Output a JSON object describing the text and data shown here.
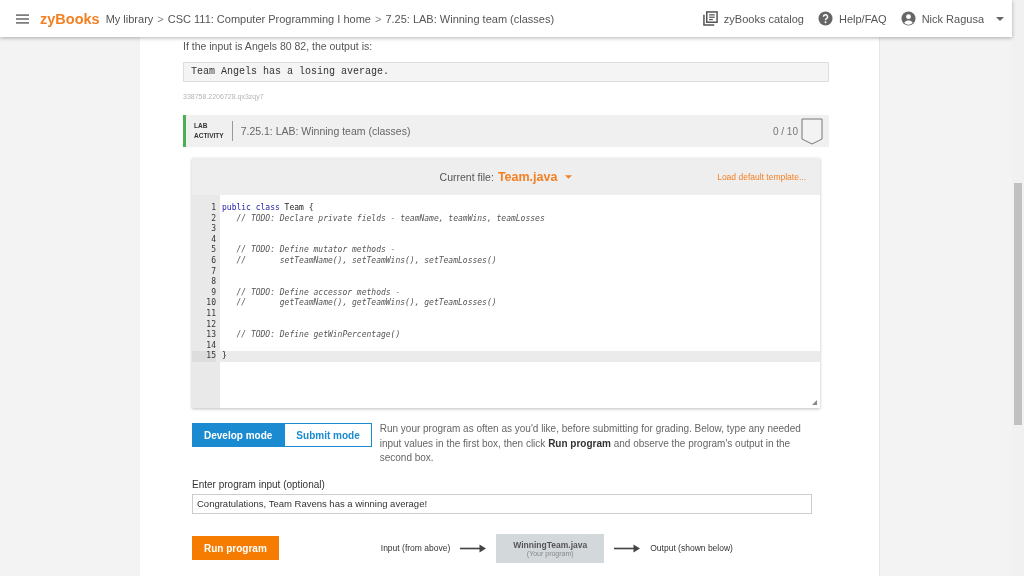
{
  "header": {
    "logo": "zyBooks",
    "breadcrumb": [
      {
        "kind": "link",
        "text": "My library"
      },
      {
        "kind": "sep",
        "text": ">"
      },
      {
        "kind": "link",
        "text": "CSC 111: Computer Programming I home"
      },
      {
        "kind": "sep",
        "text": ">"
      },
      {
        "kind": "link",
        "text": "7.25: LAB: Winning team (classes)"
      }
    ],
    "catalog": "zyBooks catalog",
    "help": "Help/FAQ",
    "user": "Nick Ragusa"
  },
  "example": {
    "intro": "If the input is Angels 80 82, the output is:",
    "output": "Team Angels has a losing average.",
    "id": "338758.2206728.qx3zqy7"
  },
  "lab": {
    "tag_line1": "LAB",
    "tag_line2": "ACTIVITY",
    "title": "7.25.1: LAB: Winning team (classes)",
    "score": "0 / 10",
    "current_file_label": "Current file:",
    "current_file": "Team.java",
    "load_template": "Load default template...",
    "lines": [
      {
        "number": "1",
        "active": false,
        "tokens": [
          {
            "kind": "keyword",
            "text": "public class"
          },
          {
            "kind": "plain",
            "text": " Team {"
          }
        ]
      },
      {
        "number": "2",
        "active": false,
        "tokens": [
          {
            "kind": "comment",
            "text": "   // TODO: Declare private fields - teamName, teamWins, teamLosses"
          }
        ]
      },
      {
        "number": "3",
        "active": false
      },
      {
        "number": "4",
        "active": false
      },
      {
        "number": "5",
        "active": false,
        "tokens": [
          {
            "kind": "comment",
            "text": "   // TODO: Define mutator methods -"
          }
        ]
      },
      {
        "number": "6",
        "active": false,
        "tokens": [
          {
            "kind": "comment",
            "text": "   //       setTeamName(), setTeamWins(), setTeamLosses()"
          }
        ]
      },
      {
        "number": "7",
        "active": false
      },
      {
        "number": "8",
        "active": false
      },
      {
        "number": "9",
        "active": false,
        "tokens": [
          {
            "kind": "comment",
            "text": "   // TODO: Define accessor methods -"
          }
        ]
      },
      {
        "number": "10",
        "active": false,
        "tokens": [
          {
            "kind": "comment",
            "text": "   //       getTeamName(), getTeamWins(), getTeamLosses()"
          }
        ]
      },
      {
        "number": "11",
        "active": false
      },
      {
        "number": "12",
        "active": false
      },
      {
        "number": "13",
        "active": false,
        "tokens": [
          {
            "kind": "comment",
            "text": "   // TODO: Define getWinPercentage()"
          }
        ]
      },
      {
        "number": "14",
        "active": false
      },
      {
        "number": "15",
        "active": true,
        "tokens": [
          {
            "kind": "plain",
            "text": "}"
          }
        ]
      }
    ],
    "modes": [
      {
        "label": "Develop mode",
        "selected": true
      },
      {
        "label": "Submit mode",
        "selected": false
      }
    ],
    "mode_help": "Run your program as often as you'd like, before submitting for grading. Below, type any needed input values in the first box, then click **Run program** and observe the program's output in the second box.",
    "input_label": "Enter program input (optional)",
    "input_value": "Congratulations, Team Ravens has a winning average!",
    "run_button": "Run program",
    "flow_input": "Input (from above)",
    "program_name": "WinningTeam.java",
    "program_sub": "(Your program)",
    "flow_output": "Output (shown below)"
  }
}
